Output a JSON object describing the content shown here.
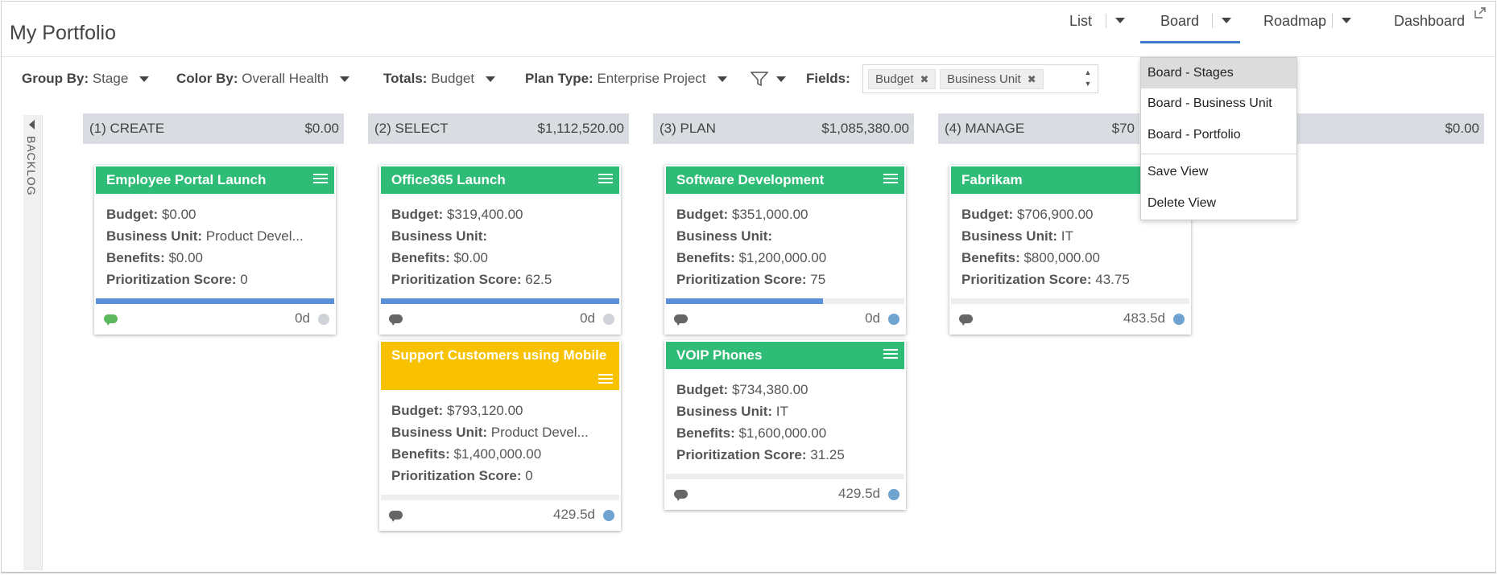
{
  "header": {
    "title": "My Portfolio",
    "tabs": [
      {
        "label": "List",
        "has_menu": true
      },
      {
        "label": "Board",
        "has_menu": true,
        "active": true
      },
      {
        "label": "Roadmap",
        "has_menu": true
      },
      {
        "label": "Dashboard",
        "has_menu": false
      }
    ]
  },
  "toolbar": {
    "group_by_label": "Group By:",
    "group_by_value": "Stage",
    "color_by_label": "Color By:",
    "color_by_value": "Overall Health",
    "totals_label": "Totals:",
    "totals_value": "Budget",
    "plan_type_label": "Plan Type:",
    "plan_type_value": "Enterprise Project",
    "fields_label": "Fields:",
    "field_chips": [
      "Budget",
      "Business Unit"
    ]
  },
  "backlog_label": "BACKLOG",
  "columns": [
    {
      "name": "(1) CREATE",
      "total": "$0.00"
    },
    {
      "name": "(2) SELECT",
      "total": "$1,112,520.00"
    },
    {
      "name": "(3) PLAN",
      "total": "$1,085,380.00"
    },
    {
      "name": "(4) MANAGE",
      "total": "$70"
    },
    {
      "name": "",
      "total": "$0.00"
    }
  ],
  "field_labels": {
    "budget": "Budget:",
    "business_unit": "Business Unit:",
    "benefits": "Benefits:",
    "score": "Prioritization Score:"
  },
  "cards": [
    {
      "title": "Employee Portal Launch",
      "budget": "$0.00",
      "business_unit": "Product Devel...",
      "benefits": "$0.00",
      "score": "0",
      "progress": 1.0,
      "duration": "0d",
      "health_color": "#cfd3d8",
      "comment_color": "#5cb85c",
      "header_color": "#2ebc77"
    },
    {
      "title": "Office365 Launch",
      "budget": "$319,400.00",
      "business_unit": "",
      "benefits": "$0.00",
      "score": "62.5",
      "progress": 1.0,
      "duration": "0d",
      "health_color": "#cfd3d8",
      "comment_color": "#666666",
      "header_color": "#2ebc77"
    },
    {
      "title": "Support Customers using Mobile",
      "budget": "$793,120.00",
      "business_unit": "Product Devel...",
      "benefits": "$1,400,000.00",
      "score": "0",
      "progress": 0.0,
      "duration": "429.5d",
      "health_color": "#6fa3d0",
      "comment_color": "#666666",
      "header_color": "#f8c200"
    },
    {
      "title": "Software Development",
      "budget": "$351,000.00",
      "business_unit": "",
      "benefits": "$1,200,000.00",
      "score": "75",
      "progress": 0.66,
      "duration": "0d",
      "health_color": "#6fa3d0",
      "comment_color": "#666666",
      "header_color": "#2ebc77"
    },
    {
      "title": "VOIP Phones",
      "budget": "$734,380.00",
      "business_unit": "IT",
      "benefits": "$1,600,000.00",
      "score": "31.25",
      "progress": 0.0,
      "duration": "429.5d",
      "health_color": "#6fa3d0",
      "comment_color": "#666666",
      "header_color": "#2ebc77"
    },
    {
      "title": "Fabrikam",
      "budget": "$706,900.00",
      "business_unit": "IT",
      "benefits": "$800,000.00",
      "score": "43.75",
      "progress": 0.0,
      "duration": "483.5d",
      "health_color": "#6fa3d0",
      "comment_color": "#666666",
      "header_color": "#2ebc77"
    }
  ],
  "board_menu": {
    "items": [
      "Board - Stages",
      "Board - Business Unit",
      "Board - Portfolio"
    ],
    "actions": [
      "Save View",
      "Delete View"
    ]
  },
  "colors": {
    "accent": "#3b7cc7",
    "progress_fill": "#5b8fd8",
    "column_header_bg": "#d9dde1"
  }
}
